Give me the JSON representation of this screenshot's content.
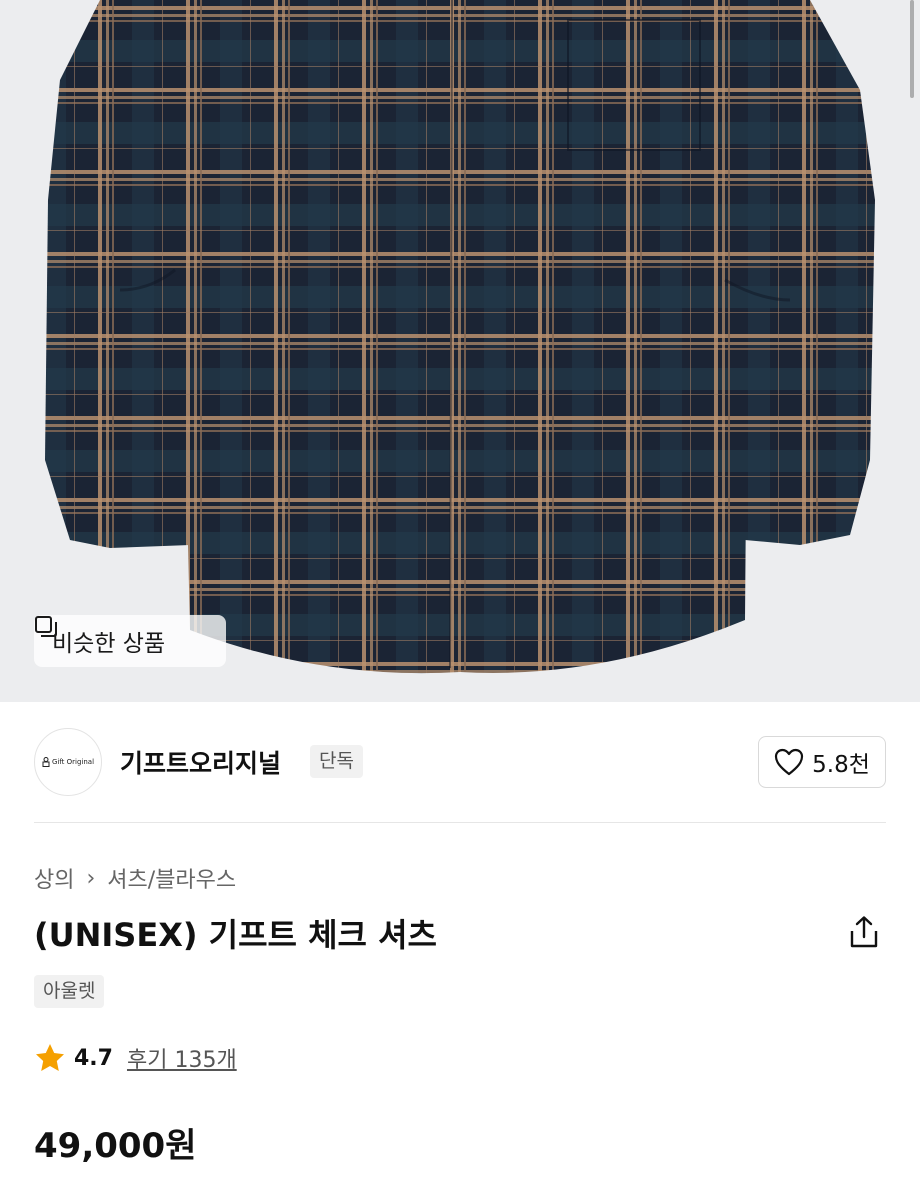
{
  "hero": {
    "image_subject": "navy-brown-plaid-shirt-photo",
    "similar_button_label": "비슷한 상품"
  },
  "brand": {
    "logo_text": "Gift Original",
    "name": "기프트오리지널",
    "badge": "단독",
    "like_count": "5.8천"
  },
  "product": {
    "breadcrumb": [
      "상의",
      "셔츠/블라우스"
    ],
    "title": "(UNISEX) 기프트 체크 셔츠",
    "tag": "아울렛",
    "rating": "4.7",
    "review_label": "후기 135개",
    "price": "49,000원"
  },
  "colors": {
    "accent_star": "#f5a000",
    "shirt_navy": "#1c2536",
    "shirt_tan": "#b08a6a"
  }
}
